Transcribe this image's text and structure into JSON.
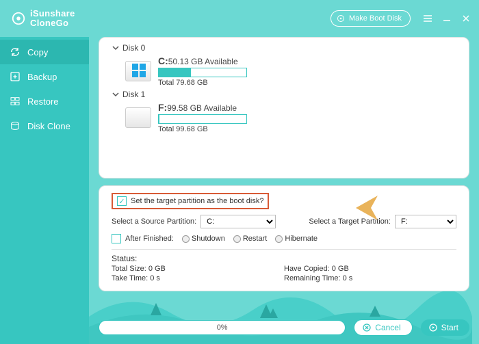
{
  "brand": {
    "line1": "iSunshare",
    "line2": "CloneGo"
  },
  "titlebar": {
    "make_boot": "Make Boot Disk"
  },
  "nav": {
    "copy": "Copy",
    "backup": "Backup",
    "restore": "Restore",
    "disk_clone": "Disk Clone"
  },
  "disks": [
    {
      "title": "Disk 0",
      "partition": {
        "letter": "C:",
        "avail": "50.13 GB Available",
        "total_label": "Total 79.68 GB",
        "used_pct": 37,
        "is_system": true
      }
    },
    {
      "title": "Disk 1",
      "partition": {
        "letter": "F:",
        "avail": "99.58 GB Available",
        "total_label": "Total 99.68 GB",
        "used_pct": 1,
        "is_system": false
      }
    }
  ],
  "options": {
    "boot_checkbox_label": "Set the target partition as the boot disk?",
    "boot_checked": true,
    "source_label": "Select a Source Partition:",
    "target_label": "Select a Target Partition:",
    "source_value": "C:",
    "target_value": "F:",
    "after_label": "After Finished:",
    "after_checked": false,
    "radios": {
      "shutdown": "Shutdown",
      "restart": "Restart",
      "hibernate": "Hibernate"
    }
  },
  "status": {
    "heading": "Status:",
    "total_size_label": "Total Size:",
    "total_size_value": "0 GB",
    "have_copied_label": "Have Copied:",
    "have_copied_value": "0 GB",
    "take_time_label": "Take Time:",
    "take_time_value": "0 s",
    "remaining_label": "Remaining Time:",
    "remaining_value": "0 s"
  },
  "footer": {
    "progress_text": "0%",
    "cancel": "Cancel",
    "start": "Start"
  },
  "colors": {
    "accent": "#37c6c0",
    "callout": "#d85a36"
  }
}
